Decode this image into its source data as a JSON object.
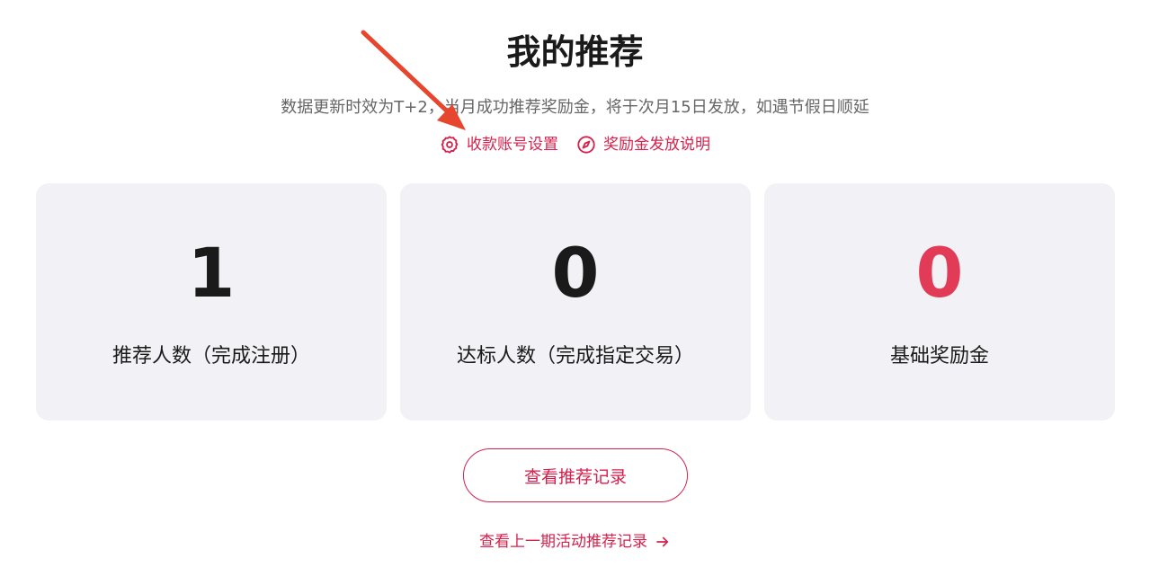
{
  "header": {
    "title": "我的推荐",
    "subtitle": "数据更新时效为T+2，当月成功推荐奖励金，将于次月15日发放，如遇节假日顺延"
  },
  "links": {
    "account_settings": {
      "label": "收款账号设置",
      "icon": "gear-icon"
    },
    "reward_explanation": {
      "label": "奖励金发放说明",
      "icon": "compass-icon"
    }
  },
  "stats": [
    {
      "value": "1",
      "label": "推荐人数（完成注册）"
    },
    {
      "value": "0",
      "label": "达标人数（完成指定交易）"
    },
    {
      "value": "0",
      "label": "基础奖励金"
    }
  ],
  "actions": {
    "view_records": "查看推荐记录",
    "view_previous": "查看上一期活动推荐记录",
    "view_previous_icon": "arrow-right-icon"
  },
  "colors": {
    "accent": "#d6214c",
    "reward_value": "#e23b57",
    "card_bg": "#f2f2f6",
    "annotation_arrow": "#e8452e"
  }
}
